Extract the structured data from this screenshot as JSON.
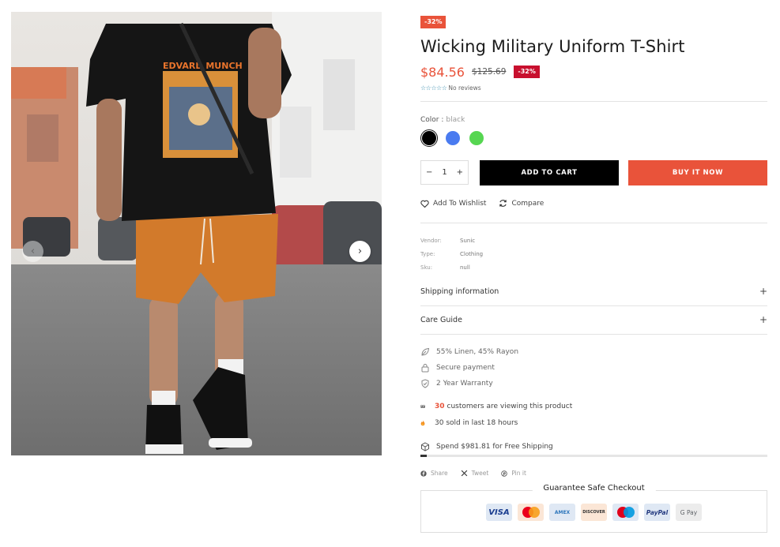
{
  "gallery": {
    "prev_glyph": "‹",
    "next_glyph": "›",
    "shirt_print_text": "EDVARD MUNCH"
  },
  "product": {
    "top_badge": "-32%",
    "title": "Wicking Military Uniform T-Shirt",
    "price": "$84.56",
    "compare_price": "$125.69",
    "discount_badge": "-32%",
    "stars": "☆☆☆☆☆",
    "reviews": "No reviews",
    "rating": 0
  },
  "color": {
    "label": "Color :",
    "selected": "black",
    "swatches": [
      {
        "name": "black",
        "hex": "#000000"
      },
      {
        "name": "blue",
        "hex": "#4a7bf0"
      },
      {
        "name": "green",
        "hex": "#56d651"
      }
    ]
  },
  "purchase": {
    "minus": "−",
    "quantity": "1",
    "plus": "+",
    "add_to_cart": "ADD TO CART",
    "buy_now": "BUY IT NOW"
  },
  "actions": {
    "wishlist": "Add To Wishlist",
    "compare": "Compare"
  },
  "meta": [
    {
      "key": "Vendor:",
      "value": "Sunic"
    },
    {
      "key": "Type:",
      "value": "Clothing"
    },
    {
      "key": "Sku:",
      "value": "null"
    }
  ],
  "accordions": {
    "shipping": "Shipping information",
    "care": "Care Guide",
    "plus": "+"
  },
  "features": {
    "material": "55% Linen, 45% Rayon",
    "payment": "Secure payment",
    "warranty": "2 Year Warranty",
    "viewing_count": "30",
    "viewing_text": "customers are viewing this product",
    "sold_text": "30 sold in last 18 hours",
    "shipping_text": "Spend $981.81 for Free Shipping",
    "shipping_progress": 0.018
  },
  "share": {
    "facebook": "Share",
    "twitter": "Tweet",
    "pinterest": "Pin it"
  },
  "checkout": {
    "title": "Guarantee Safe Checkout",
    "methods": [
      {
        "name": "visa",
        "label": "VISA",
        "bg": "#dfe8f4",
        "color": "#1a3d8f"
      },
      {
        "name": "mastercard",
        "label": "",
        "bg": "#fbe6d6",
        "color": "#eb001b"
      },
      {
        "name": "amex",
        "label": "AMEX",
        "bg": "#dfe8f4",
        "color": "#2e77bc"
      },
      {
        "name": "discover",
        "label": "DISCOVER",
        "bg": "#fbe6d6",
        "color": "#333333"
      },
      {
        "name": "maestro",
        "label": "",
        "bg": "#dfe8f4",
        "color": "#0099df"
      },
      {
        "name": "paypal",
        "label": "PayPal",
        "bg": "#dfe8f4",
        "color": "#253b80"
      },
      {
        "name": "gpay",
        "label": "G Pay",
        "bg": "#ececec",
        "color": "#5f6368"
      }
    ]
  },
  "colors": {
    "accent": "#e9533a",
    "badge_red": "#c8102e",
    "cart_black": "#000000"
  }
}
